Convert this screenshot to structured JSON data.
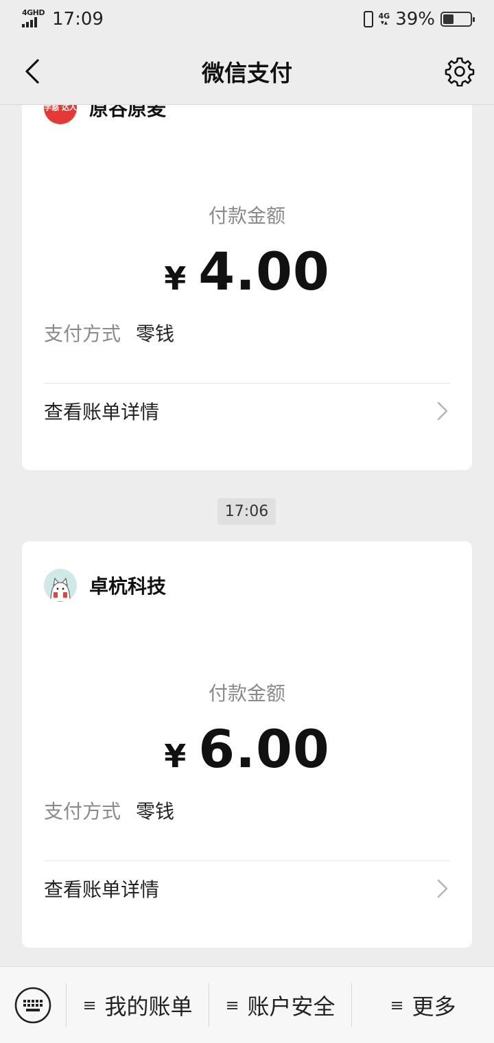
{
  "status_bar": {
    "network_left": "4GHD",
    "time": "17:09",
    "network_right": "4G",
    "battery": "39%",
    "battery_level": 0.39
  },
  "nav": {
    "title": "微信支付"
  },
  "cards": [
    {
      "merchant": "原谷原麦",
      "avatar_text": "学惑 达人",
      "amount_label": "付款金额",
      "currency": "¥",
      "amount": "4.00",
      "pay_method_label": "支付方式",
      "pay_method": "零钱",
      "detail_label": "查看账单详情"
    },
    {
      "merchant": "卓杭科技",
      "amount_label": "付款金额",
      "currency": "¥",
      "amount": "6.00",
      "pay_method_label": "支付方式",
      "pay_method": "零钱",
      "detail_label": "查看账单详情"
    }
  ],
  "timestamp": "17:06",
  "bottom_menu": {
    "items": [
      {
        "label": "我的账单"
      },
      {
        "label": "账户安全"
      },
      {
        "label": "更多"
      }
    ]
  },
  "icons": {
    "back": "chevron-left-icon",
    "settings": "gear-icon",
    "keyboard": "keyboard-icon",
    "menu": "hamburger-icon",
    "detail": "chevron-right-icon"
  }
}
